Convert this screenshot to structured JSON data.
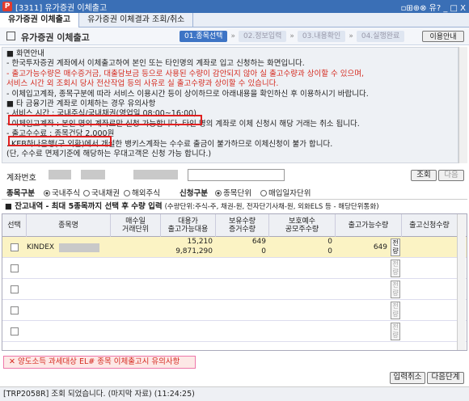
{
  "window": {
    "title": "[3311] 유가증권 이체출고",
    "icons": "▫⊞⊕⊗ 유? _ □ X"
  },
  "tabs": [
    "유가증권 이체출고",
    "유가증권 이체결과 조회/취소"
  ],
  "header": {
    "title": "유가증권 이체출고",
    "guide_button": "이용안내"
  },
  "steps": [
    "01.종목선택",
    "02.정보입력",
    "03.내용확인",
    "04.실행완료"
  ],
  "notice": [
    {
      "text": "■ 화면안내",
      "color": "normal"
    },
    {
      "text": "- 한국투자증권 계좌에서 이체출고하여 본인 또는 타인명의 계좌로 입고 신청하는 화면입니다.",
      "color": "normal"
    },
    {
      "text": "- 출고가능수량은 매수증거금, 대출담보금 등으로 사용된 수량이 감안되지 않아 실 출고수량과 상이할 수 있으며,",
      "color": "red"
    },
    {
      "text": "  서비스 시간 외 조회시 당사 전산작업 등의 사유로 실 출고수량과 상이할 수 있습니다.",
      "color": "red"
    },
    {
      "text": "- 이체입고계좌, 종목구분에 따라 서비스 이용시간 등이 상이하므로 아래내용을 확인하신 후 이용하시기 바랍니다.",
      "color": "normal"
    },
    {
      "text": "■ 타 금융기관 계좌로 이체하는 경우 유의사항",
      "color": "normal"
    },
    {
      "text": "- 서비스 시간 : 국내주식/국내채권(영업일 08:00~16:00)",
      "color": "normal"
    },
    {
      "text": "- 이체입고계좌 : 본인 명의 계좌로만 신청 가능합니다. 타인 명의 계좌로 이체 신청시 해당 거래는 취소 됩니다.",
      "color": "normal"
    },
    {
      "text": "- 출고수수료 : 종목건당 2,000원",
      "color": "normal"
    },
    {
      "text": "  . KEB하나은행(구 외환)에서 개설한 뱅키스계좌는 수수료 출금이 불가하므로 이체신청이 불가 합니다.",
      "color": "normal"
    },
    {
      "text": "  (단, 수수료 면제기준에 해당하는 우대고객은 신청 가능 합니다.)",
      "color": "normal"
    }
  ],
  "account": {
    "label": "계좌번호",
    "query_button": "조회",
    "next_button": "다음"
  },
  "filters": {
    "type_label": "종목구분",
    "options": [
      "국내주식",
      "국내채권",
      "해외주식"
    ],
    "unit_label": "신청구분",
    "unit_options": [
      "종목단위",
      "매입일자단위"
    ]
  },
  "section": {
    "title": "■ 잔고내역 - 최대 5종목까지 선택 후 수량 입력",
    "note": "(수량단위:주식-주, 채권-원, 전자단기사채-원, 외화ELS 등 - 해당단위통화)"
  },
  "table": {
    "headers": [
      "선택",
      "종목명",
      "매수일\n거래단위",
      "대용가\n출고가능대용",
      "보유수량\n증거수량",
      "보호예수\n공모주수량",
      "출고가능수량",
      "출고신청수량"
    ],
    "row": {
      "name": "KINDEX",
      "price": "15,210",
      "sub_price": "9,871,290",
      "hold": "649",
      "margin": "0",
      "protect": "0",
      "protect2": "0",
      "avail": "649",
      "btn": "전량"
    },
    "empty_btn": "전량"
  },
  "tax_notice": "✕ 양도소득 과세대상 EL# 종목 이체출고시 유의사항",
  "buttons": {
    "cancel": "입력취소",
    "next": "다음단계"
  },
  "status": "[TRP2058R] 조회 되었습니다. (마지막 자료) (11:24:25)"
}
